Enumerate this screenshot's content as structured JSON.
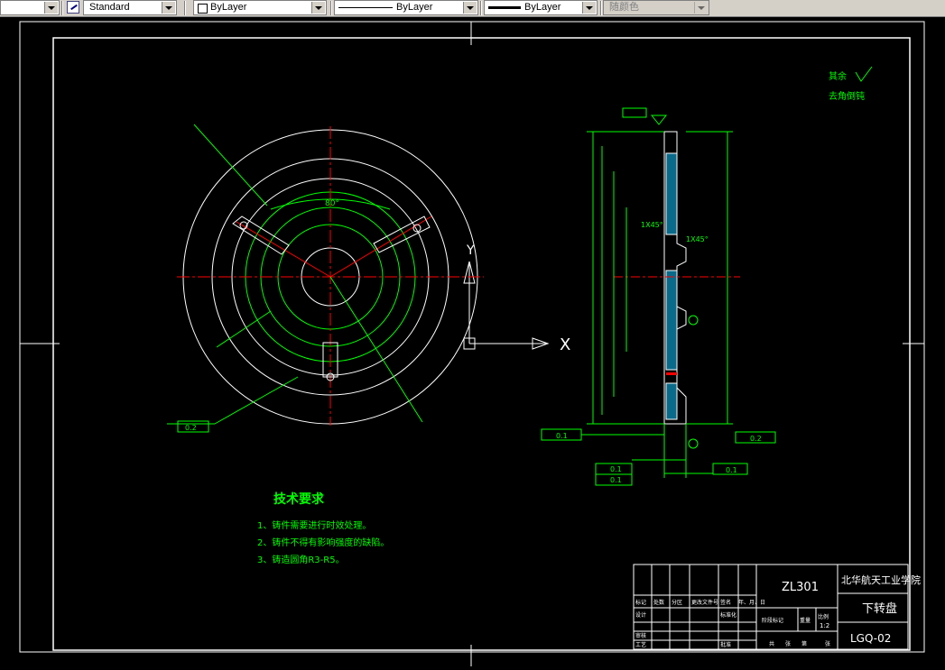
{
  "toolbar": {
    "textstyle_value": "Standard",
    "layer_value": "ByLayer",
    "linetype_value": "ByLayer",
    "lineweight_value": "ByLayer",
    "plotstyle_value": "随颜色"
  },
  "drawing": {
    "axis_y_label": "Y",
    "axis_x_label": "X",
    "roughness_note": "其余",
    "roughness_note2": "去角倒钝",
    "angle_label": "80°",
    "tech_title": "技术要求",
    "tech_items": [
      "1、铸件需要进行时效处理。",
      "2、铸件不得有影响强度的缺陷。",
      "3、铸造圆角R3-R5。"
    ],
    "datum_left": "0.2",
    "chamfer1": "1X45°",
    "chamfer2": "1X45°",
    "fcf_left_val": "0.1",
    "fcf_right_val": "0.2",
    "fcf_bottom_val1": "0.1",
    "fcf_bottom_val2": "0.1",
    "fcf_bottom_right": "0.1"
  },
  "title_block": {
    "material": "ZL301",
    "school": "北华航天工业学院",
    "part_name": "下转盘",
    "drawing_no": "LGQ-02",
    "scale": "1:2",
    "headers": [
      "标记",
      "处数",
      "分区",
      "更改文件号",
      "签名",
      "年、月、日"
    ],
    "row_design": [
      "设计",
      "",
      "",
      "标准化"
    ],
    "row_stage": [
      "阶段标记",
      "重量",
      "比例"
    ],
    "row_review": [
      "审核"
    ],
    "row_process": [
      "工艺",
      "",
      "批准"
    ],
    "sheets": [
      "共",
      "张",
      "第",
      "张"
    ]
  }
}
